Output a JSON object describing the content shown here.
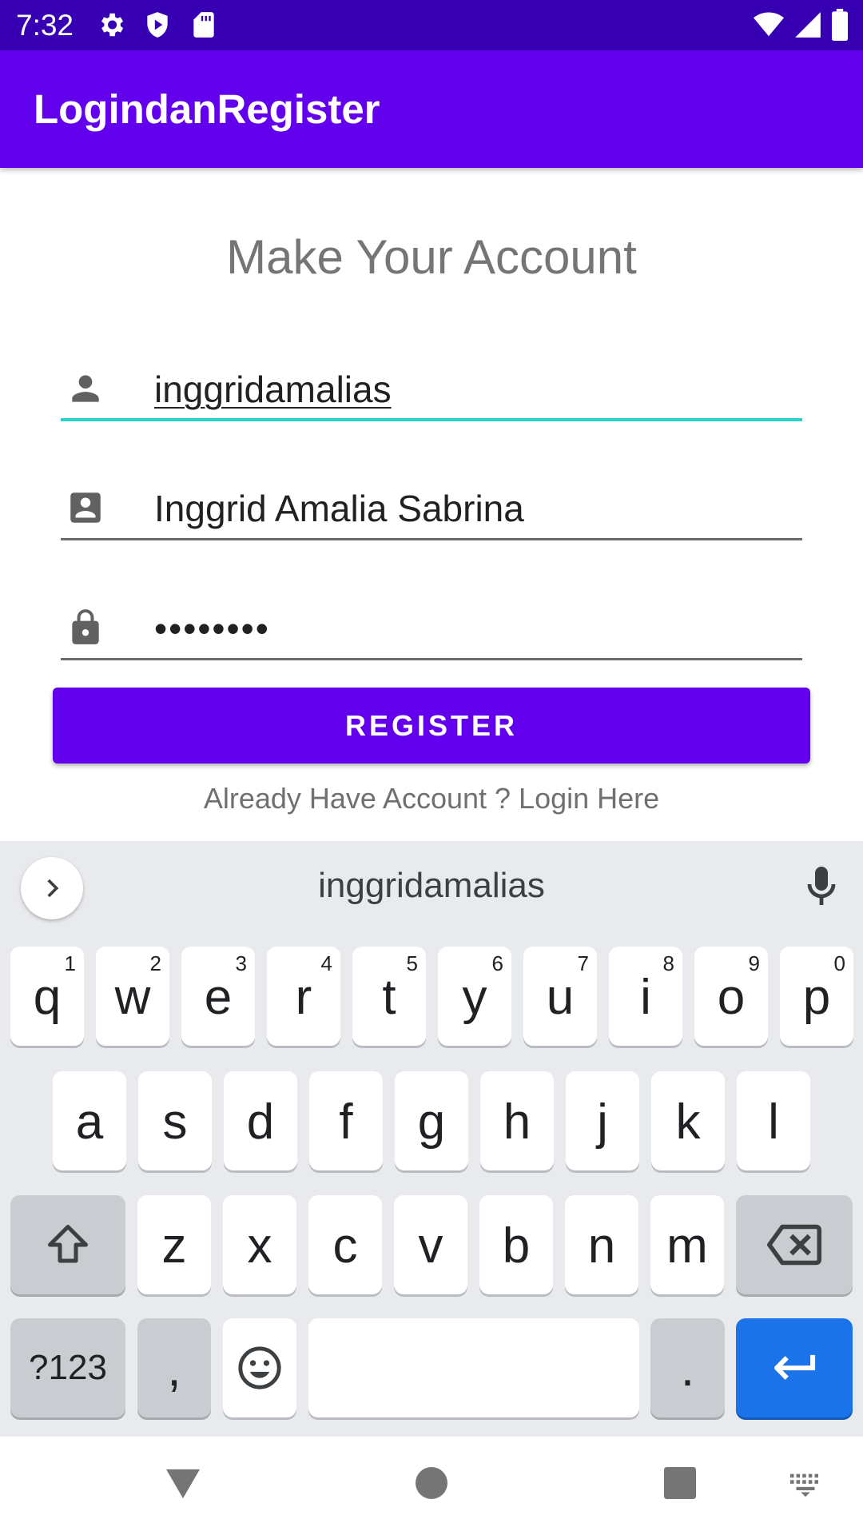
{
  "status_bar": {
    "time": "7:32",
    "icons_left": [
      "gear-icon",
      "shield-play-icon",
      "sd-card-icon"
    ],
    "icons_right": [
      "wifi-icon",
      "cell-signal-icon",
      "battery-icon"
    ]
  },
  "app_bar": {
    "title": "LogindanRegister"
  },
  "form": {
    "heading": "Make Your Account",
    "username_value": "inggridamalias",
    "fullname_value": "Inggrid Amalia Sabrina",
    "password_value": "••••••••",
    "register_label": "REGISTER",
    "login_link": "Already Have Account ? Login Here"
  },
  "keyboard": {
    "suggestion": "inggridamalias",
    "row1": [
      {
        "k": "q",
        "h": "1"
      },
      {
        "k": "w",
        "h": "2"
      },
      {
        "k": "e",
        "h": "3"
      },
      {
        "k": "r",
        "h": "4"
      },
      {
        "k": "t",
        "h": "5"
      },
      {
        "k": "y",
        "h": "6"
      },
      {
        "k": "u",
        "h": "7"
      },
      {
        "k": "i",
        "h": "8"
      },
      {
        "k": "o",
        "h": "9"
      },
      {
        "k": "p",
        "h": "0"
      }
    ],
    "row2": [
      "a",
      "s",
      "d",
      "f",
      "g",
      "h",
      "j",
      "k",
      "l"
    ],
    "row3": [
      "z",
      "x",
      "c",
      "v",
      "b",
      "n",
      "m"
    ],
    "symbols_label": "?123",
    "comma_label": ",",
    "period_label": "."
  },
  "colors": {
    "status_bar": "#3700b3",
    "primary": "#6200ee",
    "focus_underline": "#2ad3c9",
    "enter_key": "#1a73e8"
  }
}
